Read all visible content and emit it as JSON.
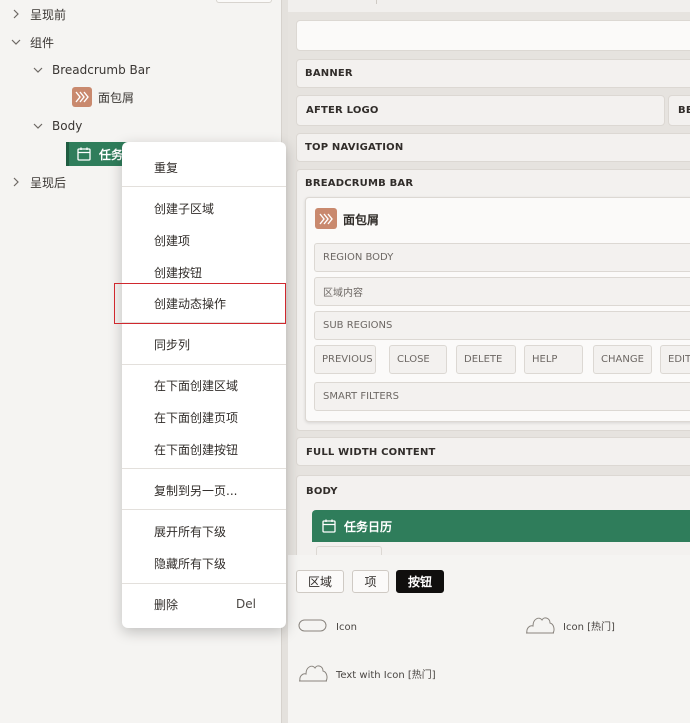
{
  "tree": {
    "nodes": [
      {
        "label": "呈现前"
      },
      {
        "label": "组件"
      },
      {
        "label": "Breadcrumb Bar"
      },
      {
        "label": "面包屑"
      },
      {
        "label": "Body"
      },
      {
        "label": "任务"
      },
      {
        "label": "呈现后"
      }
    ]
  },
  "canvas": {
    "banner": "BANNER",
    "after_logo": "AFTER LOGO",
    "before_nav": "BEF",
    "top_navigation": "TOP NAVIGATION",
    "breadcrumb_bar": "BREADCRUMB BAR",
    "breadcrumb_region": {
      "title": "面包屑",
      "region_body": "REGION BODY",
      "region_content": "区域内容",
      "sub_regions": "SUB REGIONS",
      "buttons": [
        "PREVIOUS",
        "CLOSE",
        "DELETE",
        "HELP",
        "CHANGE",
        "EDIT"
      ],
      "smart_filters": "SMART FILTERS"
    },
    "full_width_content": "FULL WIDTH CONTENT",
    "body": "BODY",
    "task_calendar": "任务日历"
  },
  "gallery": {
    "tabs": [
      "区域",
      "项",
      "按钮"
    ],
    "active_tab": "按钮",
    "items": [
      "Icon",
      "Icon [热门]",
      "Text with Icon [热门]"
    ]
  },
  "context_menu": {
    "items": [
      {
        "label": "重复"
      },
      {
        "label": "创建子区域"
      },
      {
        "label": "创建项"
      },
      {
        "label": "创建按钮"
      },
      {
        "label": "创建动态操作"
      },
      {
        "label": "同步列"
      },
      {
        "label": "在下面创建区域"
      },
      {
        "label": "在下面创建页项"
      },
      {
        "label": "在下面创建按钮"
      },
      {
        "label": "复制到另一页..."
      },
      {
        "label": "展开所有下级"
      },
      {
        "label": "隐藏所有下级"
      },
      {
        "label": "删除",
        "shortcut": "Del"
      }
    ],
    "highlighted": "创建动态操作"
  },
  "colors": {
    "accent_green": "#2f7d5b",
    "breadcrumb_icon": "#c9896e",
    "highlight_border": "#d0282e"
  }
}
